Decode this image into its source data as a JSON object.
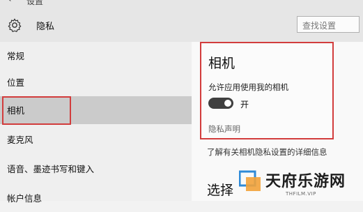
{
  "topbar": {
    "back_icon": "back-arrow-icon",
    "title": "设置"
  },
  "header": {
    "icon": "gear-icon",
    "title": "隐私",
    "search_placeholder": "查找设置"
  },
  "sidebar": {
    "items": [
      {
        "label": "常规",
        "selected": false
      },
      {
        "label": "位置",
        "selected": false
      },
      {
        "label": "相机",
        "selected": true
      },
      {
        "label": "麦克风",
        "selected": false
      },
      {
        "label": "语音、墨迹书写和键入",
        "selected": false
      },
      {
        "label": "帐户信息",
        "selected": false
      }
    ]
  },
  "camera": {
    "title": "相机",
    "allow_label": "允许应用使用我的相机",
    "toggle_state": "开",
    "toggle_on": true,
    "privacy_link": "隐私声明"
  },
  "main": {
    "learn_more_link": "了解有关相机隐私设置的详细信息",
    "section_heading_partial": "选择"
  },
  "watermark": {
    "text": "天府乐游网",
    "subtext": "THFILM.VIP"
  },
  "colors": {
    "highlight_border": "#d23c3c",
    "toggle_on": "#3f3f3f",
    "selected_nav": "#cbcbcb",
    "watermark_blue": "#2f8ad8"
  }
}
